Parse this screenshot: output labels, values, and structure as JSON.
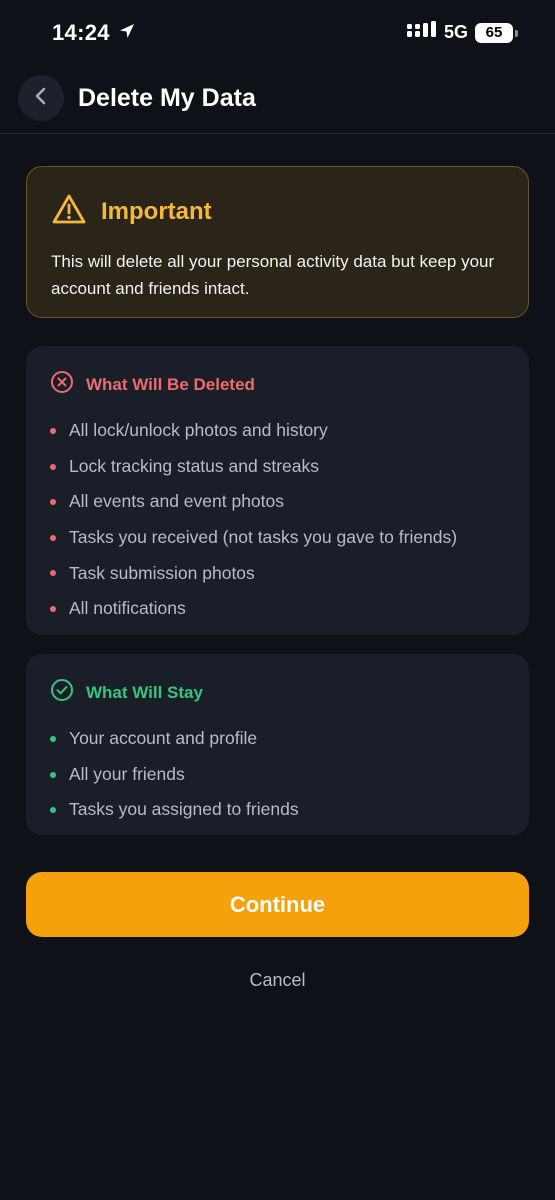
{
  "status_bar": {
    "time": "14:24",
    "network": "5G",
    "battery": "65"
  },
  "header": {
    "title": "Delete My Data"
  },
  "important": {
    "title": "Important",
    "text": "This will delete all your personal activity data but keep your account and friends intact."
  },
  "deleted_section": {
    "title": "What Will Be Deleted",
    "items": [
      "All lock/unlock photos and history",
      "Lock tracking status and streaks",
      "All events and event photos",
      "Tasks you received (not tasks you gave to friends)",
      "Task submission photos",
      "All notifications"
    ]
  },
  "stay_section": {
    "title": "What Will Stay",
    "items": [
      "Your account and profile",
      "All your friends",
      "Tasks you assigned to friends"
    ]
  },
  "actions": {
    "continue_label": "Continue",
    "cancel_label": "Cancel"
  },
  "colors": {
    "accent": "#f5a10c",
    "warning": "#f5b93a",
    "danger": "#ee6b6b",
    "success": "#34c77b"
  }
}
